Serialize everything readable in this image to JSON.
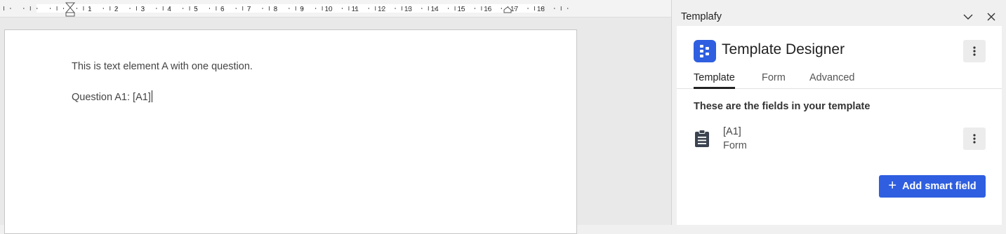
{
  "ruler": {
    "numbers": [
      "1",
      "2",
      "3",
      "4",
      "5",
      "6",
      "7",
      "8",
      "9",
      "10",
      "11",
      "12",
      "13",
      "14",
      "15",
      "16",
      "17",
      "18"
    ]
  },
  "document": {
    "line1": "This is text element A with one question.",
    "line2": "Question A1: [A1]"
  },
  "pane": {
    "title": "Templafy",
    "chevron_icon": "chevron-down-icon",
    "close_icon": "close-icon"
  },
  "designer": {
    "title": "Template Designer",
    "logo_icon": "templafy-logo",
    "tabs": [
      {
        "label": "Template",
        "active": true
      },
      {
        "label": "Form",
        "active": false
      },
      {
        "label": "Advanced",
        "active": false
      }
    ],
    "section_text": "These are the fields in your template",
    "fields": [
      {
        "name": "[A1]",
        "type": "Form",
        "icon": "clipboard-icon"
      }
    ],
    "add_button_label": "Add smart field",
    "accent_color": "#2f5fe0"
  }
}
